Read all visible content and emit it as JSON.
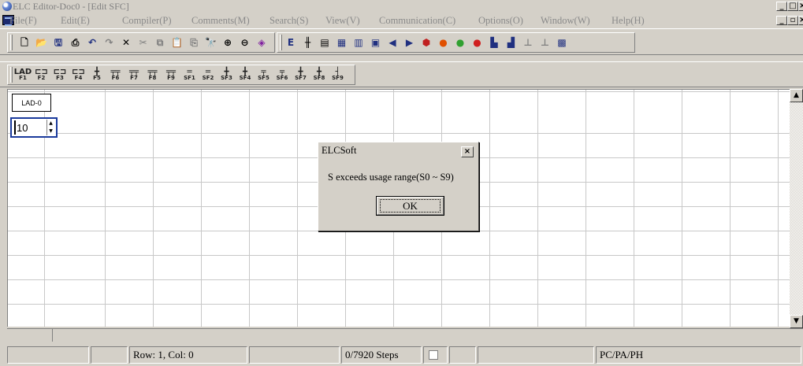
{
  "window": {
    "title": "ELC Editor-Doc0 - [Edit SFC]",
    "controls": {
      "minimize": "_",
      "maximize": "□",
      "close": "×"
    },
    "doc_controls": {
      "minimize": "_",
      "restore": "▫",
      "close": "×"
    }
  },
  "menu": {
    "items": [
      "File(F)",
      "Edit(E)",
      "Compiler(P)",
      "Comments(M)",
      "Search(S)",
      "View(V)",
      "Communication(C)",
      "Options(O)",
      "Window(W)",
      "Help(H)"
    ]
  },
  "toolbar1": {
    "icons": [
      "new-file-icon",
      "open-folder-icon",
      "save-icon",
      "print-icon",
      "undo-icon",
      "redo-icon",
      "delete-icon",
      "cut-icon",
      "copy-icon",
      "paste-icon",
      "paste-special-icon",
      "find-icon",
      "zoom-in-icon",
      "zoom-out-icon",
      "compile-icon",
      "end-icon",
      "ladder-icon",
      "instruction-icon",
      "sfc-icon",
      "monitor-icon",
      "table-icon",
      "left-icon",
      "right-icon",
      "run-record-icon",
      "run-icon",
      "stop-icon",
      "device-icon",
      "write-icon",
      "contact-icon",
      "code-icon",
      "binary-icon",
      "transfer-icon"
    ]
  },
  "toolbar2": {
    "keys": [
      {
        "sym": "LAD",
        "label": "F1"
      },
      {
        "sym": "⊏⊐",
        "label": "F2"
      },
      {
        "sym": "⊏⊐",
        "label": "F3"
      },
      {
        "sym": "⊏⊐",
        "label": "F4"
      },
      {
        "sym": "╋",
        "label": "F5"
      },
      {
        "sym": "╤╤",
        "label": "F6"
      },
      {
        "sym": "╤╤",
        "label": "F7"
      },
      {
        "sym": "╤╤",
        "label": "F8"
      },
      {
        "sym": "╤╤",
        "label": "F9"
      },
      {
        "sym": "═",
        "label": "SF1"
      },
      {
        "sym": "═",
        "label": "SF2"
      },
      {
        "sym": "╋",
        "label": "SF3"
      },
      {
        "sym": "╋",
        "label": "SF4"
      },
      {
        "sym": "╤",
        "label": "SF5"
      },
      {
        "sym": "╤",
        "label": "SF6"
      },
      {
        "sym": "╋",
        "label": "SF7"
      },
      {
        "sym": "╋",
        "label": "SF8"
      },
      {
        "sym": "┤",
        "label": "SF9"
      }
    ]
  },
  "editor": {
    "lad_block": "LAD-0",
    "step_input": "10"
  },
  "dialog": {
    "title": "ELCSoft",
    "message": "S exceeds usage range(S0 ~ S9)",
    "ok": "OK"
  },
  "status": {
    "position": "Row: 1, Col: 0",
    "steps": "0/7920 Steps",
    "plc": "PC/PA/PH"
  }
}
